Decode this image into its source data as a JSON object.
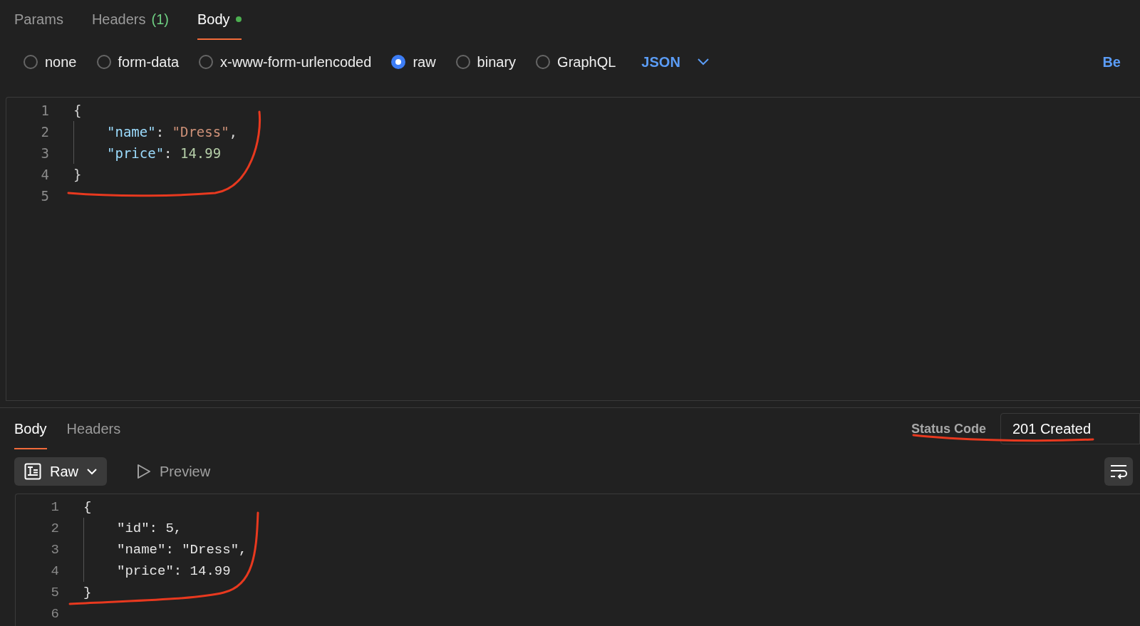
{
  "request_tabs": [
    {
      "label": "Params",
      "selected": false
    },
    {
      "label": "Headers",
      "count": "(1)",
      "selected": false
    },
    {
      "label": "Body",
      "selected": true,
      "dot": true
    }
  ],
  "body_modes": [
    {
      "label": "none",
      "selected": false
    },
    {
      "label": "form-data",
      "selected": false
    },
    {
      "label": "x-www-form-urlencoded",
      "selected": false
    },
    {
      "label": "raw",
      "selected": true
    },
    {
      "label": "binary",
      "selected": false
    },
    {
      "label": "GraphQL",
      "selected": false
    }
  ],
  "format_select": {
    "value": "JSON"
  },
  "beautify_link": "Be",
  "request_editor": {
    "lines": [
      {
        "number": "1",
        "indented": false,
        "tokens": [
          {
            "kind": "punct",
            "text": "{"
          }
        ]
      },
      {
        "number": "2",
        "indented": true,
        "tokens": [
          {
            "kind": "key",
            "text": "\"name\""
          },
          {
            "kind": "punct",
            "text": ": "
          },
          {
            "kind": "string",
            "text": "\"Dress\""
          },
          {
            "kind": "punct",
            "text": ","
          }
        ]
      },
      {
        "number": "3",
        "indented": true,
        "tokens": [
          {
            "kind": "key",
            "text": "\"price\""
          },
          {
            "kind": "punct",
            "text": ": "
          },
          {
            "kind": "number",
            "text": "14.99"
          }
        ]
      },
      {
        "number": "4",
        "indented": false,
        "tokens": [
          {
            "kind": "punct",
            "text": "}"
          }
        ]
      },
      {
        "number": "5",
        "indented": false
      }
    ]
  },
  "response_tabs": [
    {
      "label": "Body",
      "selected": true
    },
    {
      "label": "Headers",
      "selected": false
    }
  ],
  "status": {
    "label": "Status Code",
    "value": "201 Created"
  },
  "view_modes": [
    {
      "label": "Raw",
      "selected": true
    },
    {
      "label": "Preview",
      "selected": false
    }
  ],
  "response_editor": {
    "lines": [
      {
        "number": "1",
        "indented": false,
        "text": "{"
      },
      {
        "number": "2",
        "indented": true,
        "text": "\"id\": 5,"
      },
      {
        "number": "3",
        "indented": true,
        "text": "\"name\": \"Dress\","
      },
      {
        "number": "4",
        "indented": true,
        "text": "\"price\": 14.99"
      },
      {
        "number": "5",
        "indented": false,
        "text": "}"
      },
      {
        "number": "6",
        "indented": false
      }
    ]
  }
}
